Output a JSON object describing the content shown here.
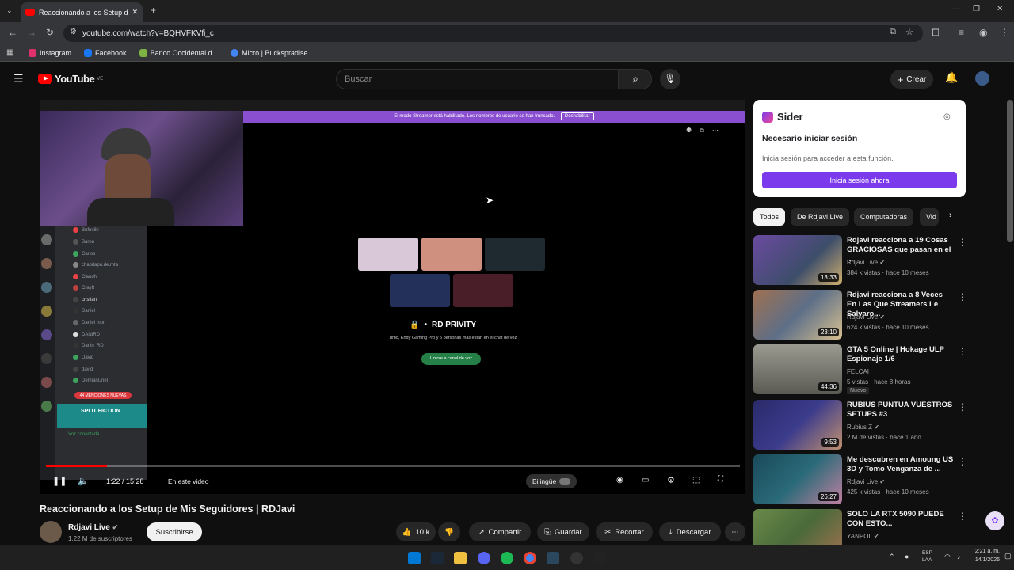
{
  "browser": {
    "tab_title": "Reaccionando a los Setup d",
    "url": "youtube.com/watch?v=BQHVFKVfi_c",
    "bookmarks": [
      {
        "label": "Instagram",
        "color": "#e1306c"
      },
      {
        "label": "Facebook",
        "color": "#1877f2"
      },
      {
        "label": "Banco Occidental d...",
        "color": "#7cb342"
      },
      {
        "label": "Micro | Buckspradise",
        "color": "#4285f4"
      }
    ]
  },
  "youtube": {
    "logo": "YouTube",
    "region": "VE",
    "search_placeholder": "Buscar",
    "create_label": "Crear"
  },
  "video": {
    "stream_banner": "El modo Streamer está habilitado. Los nombres de usuario se han truncado.",
    "stream_banner_button": "Deshabilitar",
    "channel_name": "RD PRIVITY",
    "voice_status": "! Timo, Endy Gaming Pro y 5 personas más están en el chat de voz",
    "join_button": "Unirse a canal de voz",
    "members": [
      "Bufnx8v",
      "Baron",
      "Carlos",
      "chapitapu.de.mta",
      "Claudh",
      "Crayft",
      "cristian",
      "Daniel",
      "Daniel mor",
      "DANIRD",
      "Darlin_RD",
      "David",
      "david",
      "DemianUriel"
    ],
    "mentions_badge": "44 MENCIONES NUEVAS",
    "split_fiction": "SPLIT FICTION",
    "voice_connected": "Voz conectada",
    "time": "1:22 / 15:28",
    "in_this_video": "En este video",
    "bilingual": "Bilingüe",
    "progress": 0.088
  },
  "info": {
    "title": "Reaccionando a los Setup de Mis Seguidores | RDJavi",
    "channel": "Rdjavi Live",
    "subscribers": "1.22 M de suscriptores",
    "subscribe": "Suscribirse",
    "likes": "10 k",
    "share": "Compartir",
    "save": "Guardar",
    "clip": "Recortar",
    "download": "Descargar"
  },
  "sider": {
    "title": "Sider",
    "heading": "Necesario iniciar sesión",
    "message": "Inicia sesión para acceder a esta función.",
    "button": "Inicia sesión ahora"
  },
  "chips": [
    "Todos",
    "De Rdjavi Live",
    "Computadoras",
    "Vid"
  ],
  "recommendations": [
    {
      "title": "Rdjavi reacciona a 19 Cosas GRACIOSAS que pasan en el ...",
      "channel": "Rdjavi Live",
      "meta": "384 k vistas · hace 10 meses",
      "duration": "13:33",
      "thumb": "#3d4d6a"
    },
    {
      "title": "Rdjavi reacciona a 8 Veces En Las Que Streamers Le Salvaro...",
      "channel": "Rdjavi Live",
      "meta": "624 k vistas · hace 10 meses",
      "duration": "23:10",
      "thumb": "#5d6f88"
    },
    {
      "title": "GTA 5 Online | Hokage ULP Espionaje 1/6",
      "channel": "FELCAI",
      "meta": "5 vistas · hace 8 horas",
      "duration": "44:36",
      "badge": "Nuevo",
      "thumb": "#7a7a72"
    },
    {
      "title": "RUBIUS PUNTUA VUESTROS SETUPS #3",
      "channel": "Rubius Z",
      "meta": "2 M de vistas · hace 1 año",
      "duration": "9:53",
      "thumb": "#3b3b8c"
    },
    {
      "title": "Me descubren en Amoung US 3D y Tomo Venganza de ...",
      "channel": "Rdjavi Live",
      "meta": "425 k vistas · hace 10 meses",
      "duration": "26:27",
      "thumb": "#2a6a78"
    },
    {
      "title": "SOLO LA RTX 5090 PUEDE CON ESTO...",
      "channel": "YANPOL",
      "meta": "",
      "duration": "",
      "thumb": "#4a6a3a"
    }
  ],
  "taskbar": {
    "lang": "ESP\nLAA",
    "clock": "2:21 a. m.",
    "date": "14/1/2026"
  }
}
